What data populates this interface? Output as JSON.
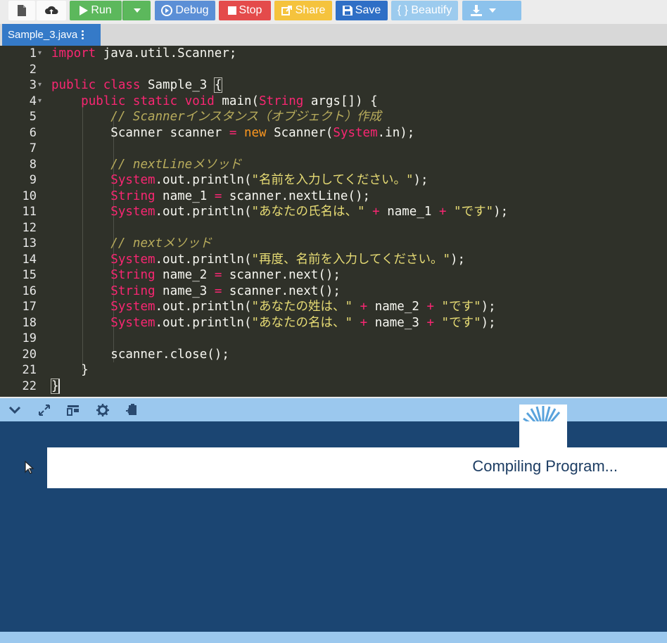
{
  "toolbar": {
    "run_label": "Run",
    "debug_label": "Debug",
    "stop_label": "Stop",
    "share_label": "Share",
    "save_label": "Save",
    "beautify_label": "{ } Beautify"
  },
  "tab": {
    "filename": "Sample_3.java"
  },
  "editor": {
    "line_numbers": [
      "1",
      "2",
      "3",
      "4",
      "5",
      "6",
      "7",
      "8",
      "9",
      "10",
      "11",
      "12",
      "13",
      "14",
      "15",
      "16",
      "17",
      "18",
      "19",
      "20",
      "21",
      "22"
    ]
  },
  "output": {
    "status": "Compiling Program..."
  },
  "colors": {
    "run": "#5cb85c",
    "debug": "#5b8fd6",
    "stop": "#e44b4b",
    "share": "#f5c33d",
    "save": "#2f6fc6",
    "editor_bg": "#2f3129",
    "panel_bg": "#1b4572"
  }
}
